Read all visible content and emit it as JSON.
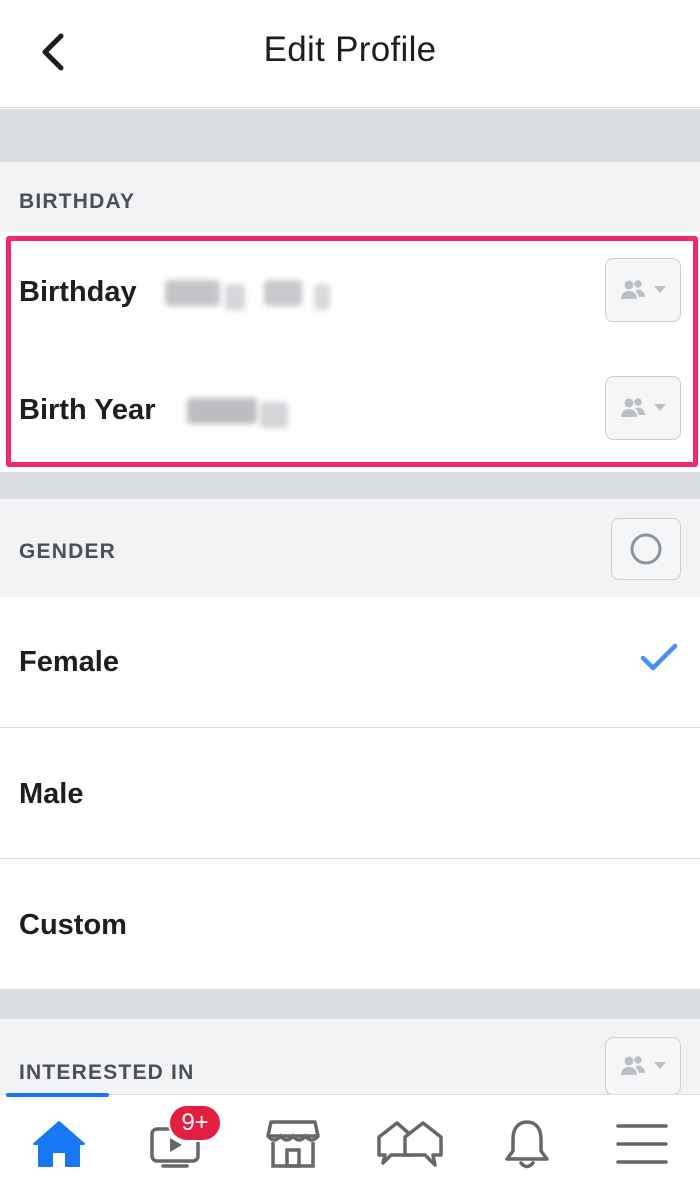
{
  "header": {
    "title": "Edit Profile"
  },
  "birthday_section": {
    "label": "BIRTHDAY",
    "rows": [
      {
        "label": "Birthday",
        "audience": "friends"
      },
      {
        "label": "Birth Year",
        "audience": "friends"
      }
    ]
  },
  "gender_section": {
    "label": "GENDER",
    "options": [
      {
        "label": "Female",
        "selected": true
      },
      {
        "label": "Male",
        "selected": false
      },
      {
        "label": "Custom",
        "selected": false
      }
    ]
  },
  "interested_section": {
    "label": "INTERESTED IN",
    "audience": "friends"
  },
  "tabbar": {
    "tabs": [
      "home",
      "watch",
      "marketplace",
      "groups",
      "notifications",
      "menu"
    ],
    "active": "home",
    "watch_badge": "9+"
  },
  "colors": {
    "accent": "#1877f2",
    "highlight": "#f0286d",
    "badge": "#e41e3f",
    "check": "#4a8ff5"
  }
}
